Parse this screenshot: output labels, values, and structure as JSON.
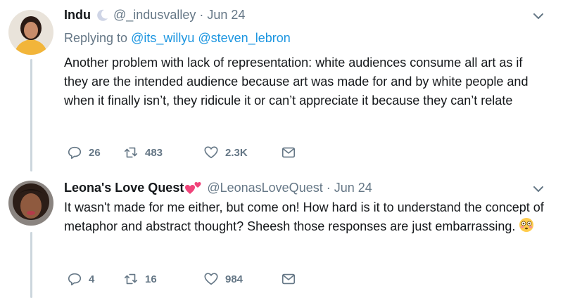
{
  "tweets": [
    {
      "name": "Indu",
      "name_icon": "crescent-moon-icon",
      "handle": "@_indusvalley",
      "date": "Jun 24",
      "replying_prefix": "Replying to",
      "replying_to": [
        "@its_willyu",
        "@steven_lebron"
      ],
      "text": "Another problem with lack of representation: white audiences consume all art as if they are the intended audience because art was made for and by white people and when it finally isn’t, they ridicule it or can’t appreciate it because they can’t relate",
      "replies": "26",
      "retweets": "483",
      "likes": "2.3K"
    },
    {
      "name": "Leona's Love Quest",
      "name_icon": "two-hearts-icon",
      "handle": "@LeonasLoveQuest",
      "date": "Jun 24",
      "text": "It wasn't made for me either, but come on! How hard is it to  understand the concept of metaphor and abstract thought? Sheesh those responses are just embarrassing.",
      "text_emoji": "flushed-face-icon",
      "replies": "4",
      "retweets": "16",
      "likes": "984"
    }
  ],
  "colors": {
    "link": "#1b95e0",
    "muted": "#657786",
    "thread": "#ccd6dd",
    "text": "#14171a"
  }
}
